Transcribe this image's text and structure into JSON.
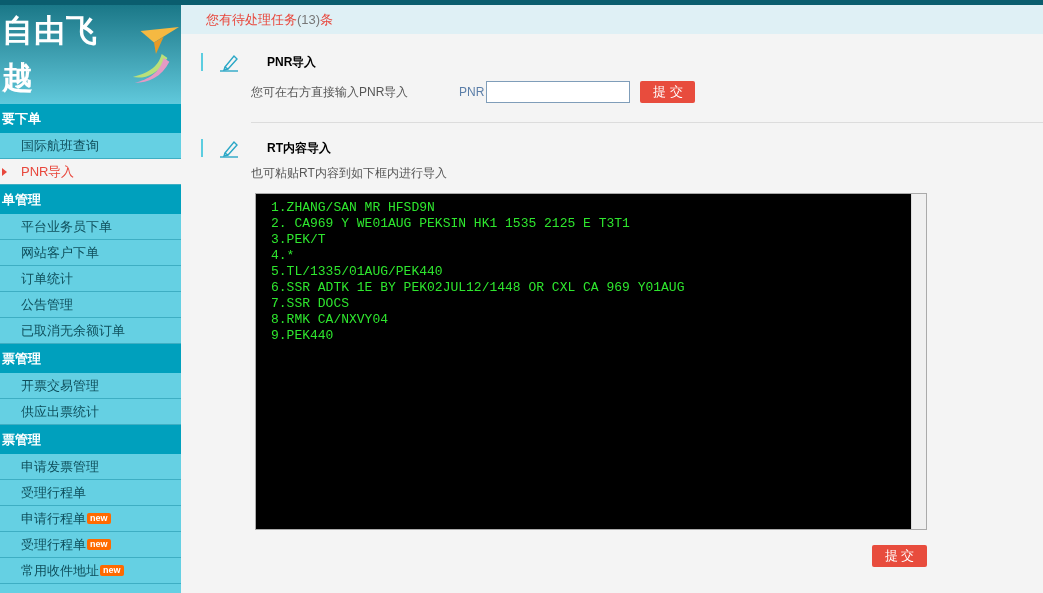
{
  "logo": {
    "text": "自由飞越"
  },
  "sidebar": {
    "groups": [
      {
        "title": "要下单",
        "items": [
          {
            "label": "国际航班查询",
            "selected": false
          },
          {
            "label": "PNR导入",
            "selected": true
          }
        ]
      },
      {
        "title": "单管理",
        "items": [
          {
            "label": "平台业务员下单",
            "selected": false
          },
          {
            "label": "网站客户下单",
            "selected": false
          },
          {
            "label": "订单统计",
            "selected": false
          },
          {
            "label": "公告管理",
            "selected": false
          },
          {
            "label": "已取消无余额订单",
            "selected": false
          }
        ]
      },
      {
        "title": "票管理",
        "items": [
          {
            "label": "开票交易管理",
            "selected": false
          },
          {
            "label": "供应出票统计",
            "selected": false
          }
        ]
      },
      {
        "title": "票管理",
        "items": [
          {
            "label": "申请发票管理",
            "selected": false
          },
          {
            "label": "受理行程单",
            "selected": false
          },
          {
            "label": "申请行程单",
            "selected": false,
            "badge": "new"
          },
          {
            "label": "受理行程单",
            "selected": false,
            "badge": "new"
          },
          {
            "label": "常用收件地址",
            "selected": false,
            "badge": "new"
          }
        ]
      }
    ]
  },
  "notice": {
    "text": "您有待处理任务",
    "count": "(13)",
    "suffix": "条"
  },
  "pnr_section": {
    "title": "PNR导入",
    "hint": "您可在右方直接输入PNR导入",
    "field_label": "PNR",
    "submit": "提 交"
  },
  "rt_section": {
    "title": "RT内容导入",
    "hint": "也可粘贴RT内容到如下框内进行导入",
    "lines": [
      "1.ZHANG/SAN MR HFSD9N",
      "2. CA969 Y WE01AUG PEKSIN HK1 1535 2125 E T3T1",
      "3.PEK/T",
      "4.*",
      "5.TL/1335/01AUG/PEK440",
      "6.SSR ADTK 1E BY PEK02JUL12/1448 OR CXL CA 969 Y01AUG",
      "7.SSR DOCS",
      "8.RMK CA/NXVY04",
      "9.PEK440"
    ],
    "submit": "提 交"
  }
}
